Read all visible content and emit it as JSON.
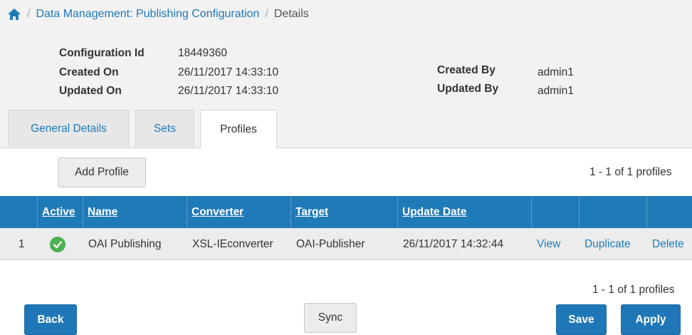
{
  "breadcrumb": {
    "separator": "/",
    "parent": "Data Management: Publishing Configuration",
    "current": "Details"
  },
  "info": {
    "config_id_label": "Configuration Id",
    "config_id_value": "18449360",
    "created_on_label": "Created On",
    "created_on_value": "26/11/2017 14:33:10",
    "updated_on_label": "Updated On",
    "updated_on_value": "26/11/2017 14:33:10",
    "created_by_label": "Created By",
    "created_by_value": "admin1",
    "updated_by_label": "Updated By",
    "updated_by_value": "admin1"
  },
  "tabs": [
    {
      "label": "General Details"
    },
    {
      "label": "Sets"
    },
    {
      "label": "Profiles"
    }
  ],
  "toolbar": {
    "add_profile_label": "Add Profile",
    "count_top": "1 - 1 of 1 profiles",
    "count_bottom": "1 - 1 of 1 profiles"
  },
  "table": {
    "headers": [
      "Active",
      "Name",
      "Converter",
      "Target",
      "Update Date"
    ],
    "rows": [
      {
        "index": "1",
        "active": true,
        "name": "OAI Publishing",
        "converter": "XSL-IEconverter",
        "target": "OAI-Publisher",
        "update_date": "26/11/2017 14:32:44",
        "view": "View",
        "duplicate": "Duplicate",
        "delete": "Delete"
      }
    ]
  },
  "footer": {
    "back_label": "Back",
    "sync_label": "Sync",
    "save_label": "Save",
    "apply_label": "Apply"
  },
  "colors": {
    "primary": "#1f7ab8",
    "active_check": "#4caf50"
  }
}
